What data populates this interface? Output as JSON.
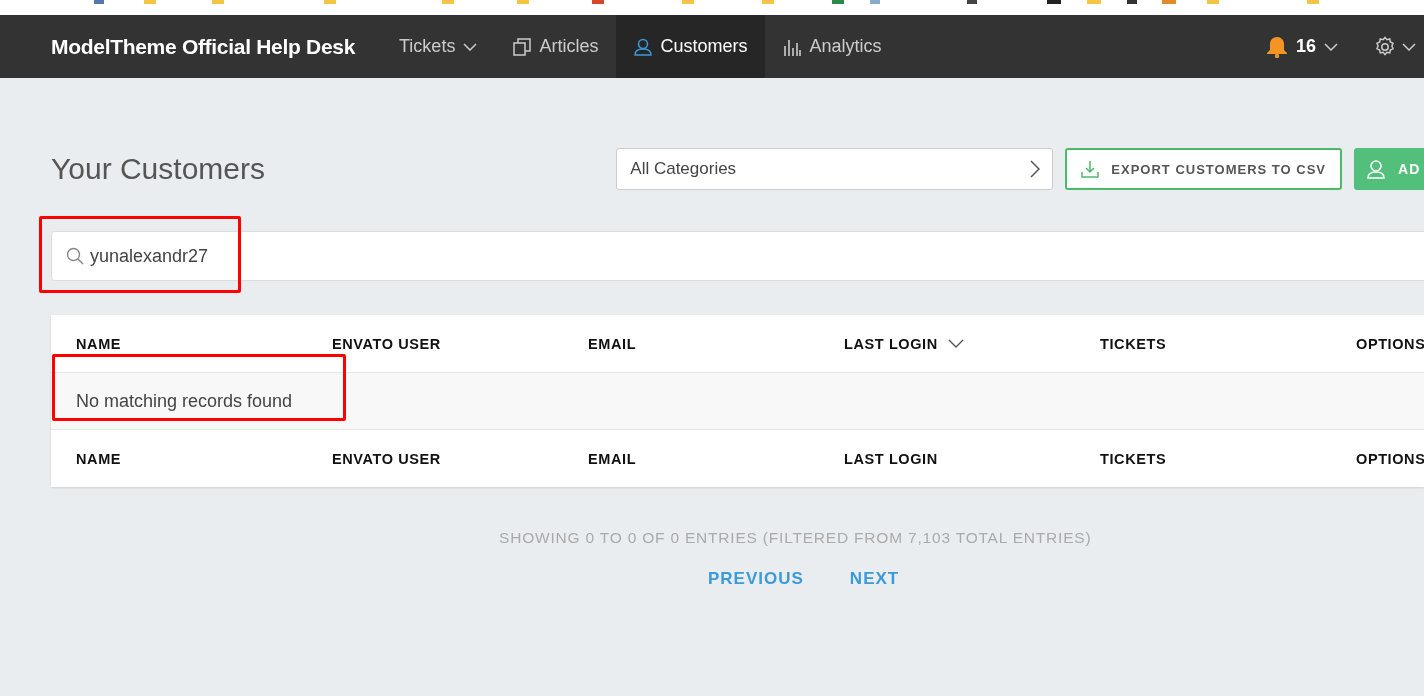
{
  "navbar": {
    "brand": "ModelTheme Official Help Desk",
    "items": [
      {
        "label": "Tickets",
        "kind": "dropdown",
        "selected": false
      },
      {
        "label": "Articles",
        "kind": "articles",
        "selected": false
      },
      {
        "label": "Customers",
        "kind": "customers",
        "selected": true
      },
      {
        "label": "Analytics",
        "kind": "analytics",
        "selected": false
      }
    ],
    "notifications": "16"
  },
  "page": {
    "title": "Your Customers",
    "category_select": "All Categories",
    "export_button": "EXPORT CUSTOMERS TO CSV",
    "add_button": "AD"
  },
  "search": {
    "value": "yunalexandr27",
    "highlighted": true
  },
  "table": {
    "columns": [
      {
        "label": "NAME",
        "sorted": false
      },
      {
        "label": "ENVATO USER",
        "sorted": false
      },
      {
        "label": "EMAIL",
        "sorted": false
      },
      {
        "label": "LAST LOGIN",
        "sorted": true
      },
      {
        "label": "TICKETS",
        "sorted": false
      },
      {
        "label": "OPTIONS",
        "sorted": false
      }
    ],
    "empty_message": "No matching records found",
    "empty_highlighted": true,
    "footer_columns": [
      "NAME",
      "ENVATO USER",
      "EMAIL",
      "LAST LOGIN",
      "TICKETS",
      "OPTIONS"
    ]
  },
  "pagination": {
    "info": "SHOWING 0 TO 0 OF 0 ENTRIES (FILTERED FROM 7,103 TOTAL ENTRIES)",
    "previous": "PREVIOUS",
    "next": "NEXT"
  }
}
